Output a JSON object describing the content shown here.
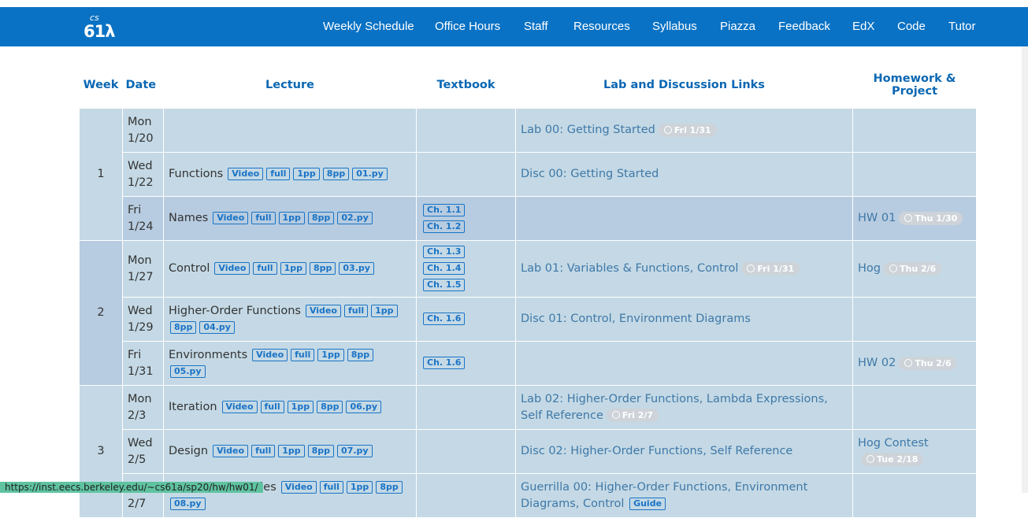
{
  "nav": {
    "logo_cs": "cs",
    "logo_num": "61λ",
    "links": [
      "Weekly Schedule",
      "Office Hours",
      "Staff",
      "Resources",
      "Syllabus",
      "Piazza",
      "Feedback",
      "EdX",
      "Code",
      "Tutor"
    ]
  },
  "table": {
    "headers": {
      "week": "Week",
      "date": "Date",
      "lecture": "Lecture",
      "textbook": "Textbook",
      "lab": "Lab and Discussion Links",
      "hw": "Homework & Project"
    },
    "rows": [
      {
        "week": "1",
        "day": "Mon",
        "date": "1/20",
        "lecture": "",
        "lecture_badges": [],
        "textbook": [],
        "lab": "Lab 00: Getting Started",
        "lab_due": "Fri 1/31",
        "hw": "",
        "hw_due": ""
      },
      {
        "day": "Wed",
        "date": "1/22",
        "lecture": "Functions",
        "lecture_badges": [
          "Video",
          "full",
          "1pp",
          "8pp",
          "01.py"
        ],
        "textbook": [],
        "lab": "Disc 00: Getting Started",
        "lab_due": "",
        "hw": "",
        "hw_due": ""
      },
      {
        "day": "Fri",
        "date": "1/24",
        "lecture": "Names",
        "lecture_badges": [
          "Video",
          "full",
          "1pp",
          "8pp",
          "02.py"
        ],
        "textbook": [
          "Ch. 1.1",
          "Ch. 1.2"
        ],
        "lab": "",
        "lab_due": "",
        "hw": "HW 01",
        "hw_due": "Thu 1/30"
      },
      {
        "week": "2",
        "day": "Mon",
        "date": "1/27",
        "lecture": "Control",
        "lecture_badges": [
          "Video",
          "full",
          "1pp",
          "8pp",
          "03.py"
        ],
        "textbook": [
          "Ch. 1.3",
          "Ch. 1.4",
          "Ch. 1.5"
        ],
        "lab": "Lab 01: Variables & Functions, Control",
        "lab_due": "Fri 1/31",
        "hw": "Hog",
        "hw_due": "Thu 2/6"
      },
      {
        "day": "Wed",
        "date": "1/29",
        "lecture": "Higher-Order Functions",
        "lecture_badges": [
          "Video",
          "full",
          "1pp",
          "8pp",
          "04.py"
        ],
        "textbook": [
          "Ch. 1.6"
        ],
        "lab": "Disc 01: Control, Environment Diagrams",
        "lab_due": "",
        "hw": "",
        "hw_due": ""
      },
      {
        "day": "Fri",
        "date": "1/31",
        "lecture": "Environments",
        "lecture_badges": [
          "Video",
          "full",
          "1pp",
          "8pp",
          "05.py"
        ],
        "textbook": [
          "Ch. 1.6"
        ],
        "lab": "",
        "lab_due": "",
        "hw": "HW 02",
        "hw_due": "Thu 2/6"
      },
      {
        "week": "3",
        "day": "Mon",
        "date": "2/3",
        "lecture": "Iteration",
        "lecture_badges": [
          "Video",
          "full",
          "1pp",
          "8pp",
          "06.py"
        ],
        "textbook": [],
        "lab": "Lab 02: Higher-Order Functions, Lambda Expressions, Self Reference",
        "lab_due": "Fri 2/7",
        "hw": "",
        "hw_due": ""
      },
      {
        "day": "Wed",
        "date": "2/5",
        "lecture": "Design",
        "lecture_badges": [
          "Video",
          "full",
          "1pp",
          "8pp",
          "07.py"
        ],
        "textbook": [],
        "lab": "Disc 02: Higher-Order Functions, Self Reference",
        "lab_due": "",
        "hw": "Hog Contest",
        "hw_due": "Tue 2/18"
      },
      {
        "day": "Fri",
        "date": "2/7",
        "lecture": "Function Examples",
        "lecture_badges": [
          "Video",
          "full",
          "1pp",
          "8pp",
          "08.py"
        ],
        "textbook": [],
        "lab": "Guerrilla 00: Higher-Order Functions, Environment Diagrams, Control",
        "lab_badge": "Guide",
        "lab_due": "",
        "hw": "",
        "hw_due": ""
      }
    ]
  },
  "status_url": "https://inst.eecs.berkeley.edu/~cs61a/sp20/hw/hw01/",
  "colors": {
    "nav": "#0a72c4",
    "cell": "#c4d9e5",
    "cell_highlight": "#b7cce0",
    "header_text": "#0a67b3",
    "badge": "#1a73c6"
  }
}
